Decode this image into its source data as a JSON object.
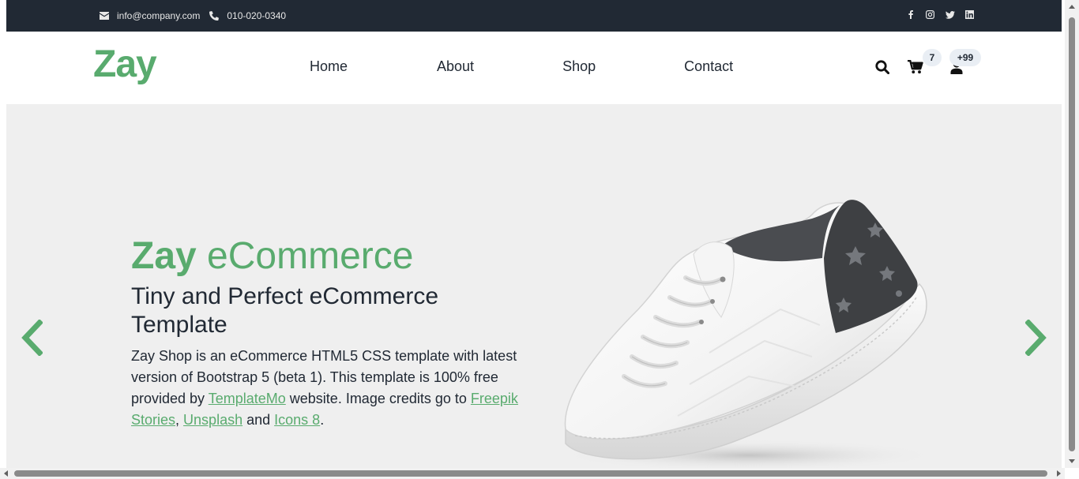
{
  "topbar": {
    "email": "info@company.com",
    "phone": "010-020-0340",
    "social": [
      "facebook-icon",
      "instagram-icon",
      "twitter-icon",
      "linkedin-icon"
    ]
  },
  "navbar": {
    "logo": "Zay",
    "links": [
      {
        "label": "Home"
      },
      {
        "label": "About"
      },
      {
        "label": "Shop"
      },
      {
        "label": "Contact"
      }
    ],
    "icons": [
      "search-icon",
      "cart-icon",
      "user-icon"
    ],
    "cart_count": "7",
    "user_count": "+99"
  },
  "hero": {
    "title_bold": "Zay",
    "title_rest": " eCommerce",
    "subtitle": "Tiny and Perfect eCommerce Template",
    "text_1": "Zay Shop is an eCommerce HTML5 CSS template with latest version of Bootstrap 5 (beta 1). This template is 100% free provided by ",
    "link_templatemo": "TemplateMo",
    "text_2": " website. Image credits go to ",
    "link_freepik": "Freepik Stories",
    "text_3": ", ",
    "link_unsplash": "Unsplash",
    "text_4": " and ",
    "link_icons8": "Icons 8",
    "text_5": "."
  },
  "colors": {
    "accent": "#59ab6e",
    "topbar_bg": "#212934",
    "hero_bg": "#efefef",
    "text": "#212934"
  }
}
